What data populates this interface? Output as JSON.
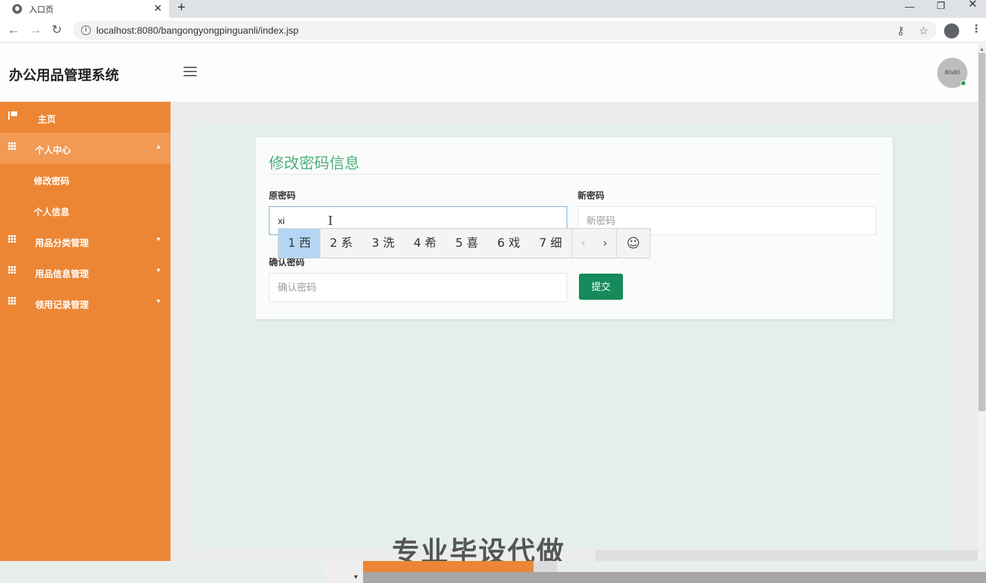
{
  "browser": {
    "tab_title": "入口页",
    "tab_close": "✕",
    "new_tab": "+",
    "url": "localhost:8080/bangongyongpinguanli/index.jsp",
    "window_controls": {
      "minimize": "—",
      "restore": "❐",
      "close": "✕"
    },
    "nav": {
      "back": "←",
      "forward": "→",
      "reload": "↻"
    },
    "icons": [
      "info-icon",
      "key-icon",
      "star-icon",
      "profile-icon",
      "menu-icon"
    ]
  },
  "header": {
    "app_title": "办公用品管理系统",
    "avatar_text": "80x80"
  },
  "sidebar": {
    "items": [
      {
        "label": "主页",
        "icon": "flag-icon",
        "caret": ""
      },
      {
        "label": "个人中心",
        "icon": "grid-icon",
        "caret": "▲"
      },
      {
        "label": "修改密码",
        "icon": "",
        "caret": ""
      },
      {
        "label": "个人信息",
        "icon": "",
        "caret": ""
      },
      {
        "label": "用品分类管理",
        "icon": "grid-icon",
        "caret": "▼"
      },
      {
        "label": "用品信息管理",
        "icon": "grid-icon",
        "caret": "▼"
      },
      {
        "label": "领用记录管理",
        "icon": "grid-icon",
        "caret": "▼"
      }
    ]
  },
  "form": {
    "title": "修改密码信息",
    "old_password": {
      "label": "原密码",
      "value": "xi"
    },
    "new_password": {
      "label": "新密码",
      "placeholder": "新密码"
    },
    "confirm_password": {
      "label": "确认密码",
      "placeholder": "确认密码"
    },
    "submit_label": "提交"
  },
  "ime": {
    "candidates": [
      "1 西",
      "2 系",
      "3 洗",
      "4 希",
      "5 喜",
      "6 戏",
      "7 细"
    ],
    "selected_index": 0,
    "prev": "‹",
    "next": "›",
    "emoji": "☺"
  },
  "overlay": {
    "watermark_text": "专业毕设代做"
  },
  "colors": {
    "sidebar": "#ec8634",
    "sidebar_active": "#f09a55",
    "title_green": "#4caf7d",
    "submit_green": "#168a5a",
    "ime_selected": "#b5d7f5"
  }
}
